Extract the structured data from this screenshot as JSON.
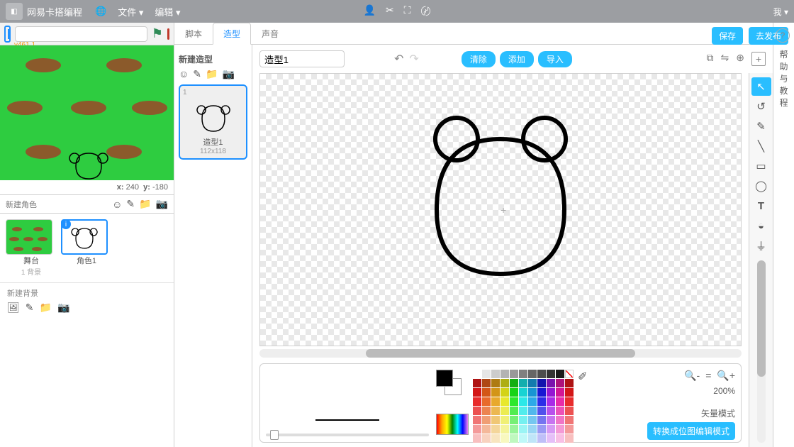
{
  "topbar": {
    "brand": "网易卡搭编程",
    "menus": {
      "file": "文件 ▾",
      "edit": "编辑 ▾"
    },
    "account": "我 ▾"
  },
  "header_buttons": {
    "save": "保存",
    "publish": "去发布"
  },
  "stage": {
    "version_label": "v461.1",
    "coords": {
      "x_label": "x:",
      "x": "240",
      "y_label": "y:",
      "y": "-180"
    }
  },
  "sprite_panel": {
    "label": "新建角色",
    "items": [
      {
        "name": "舞台",
        "sub": "1 背景"
      },
      {
        "name": "角色1"
      }
    ],
    "new_bg": "新建背景"
  },
  "tabs": {
    "scripts": "脚本",
    "costumes": "造型",
    "sounds": "声音"
  },
  "costume_panel": {
    "title": "新建造型",
    "current": {
      "index": "1",
      "name": "造型1",
      "size": "112x118"
    }
  },
  "editor": {
    "name_input": "造型1",
    "buttons": {
      "clear": "清除",
      "add": "添加",
      "import": "导入"
    }
  },
  "zoom": {
    "percent": "200%",
    "mode": "矢量模式",
    "switch": "转换成位图编辑模式"
  },
  "help": {
    "text": "帮助与教程",
    "c1": "帮",
    "c2": "助",
    "c3": "与",
    "c4": "教",
    "c5": "程"
  }
}
